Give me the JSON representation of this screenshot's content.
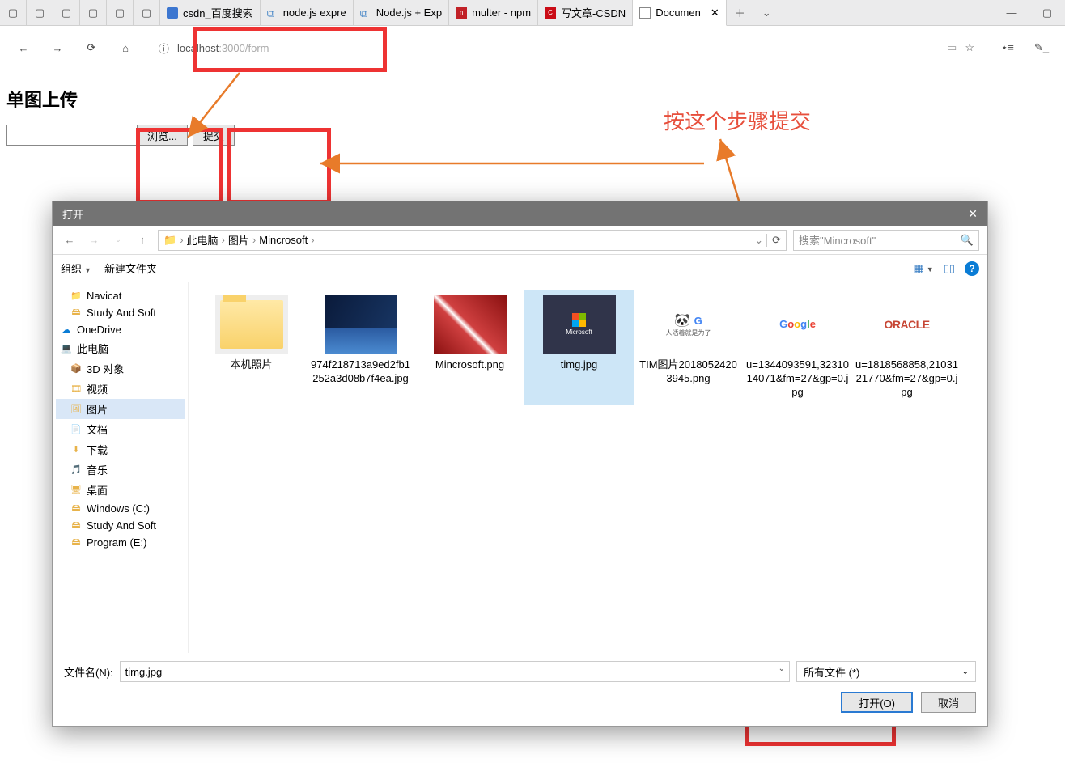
{
  "tabs": [
    {
      "label": "csdn_百度搜索"
    },
    {
      "label": "node.js expre"
    },
    {
      "label": "Node.js + Exp"
    },
    {
      "label": "multer - npm"
    },
    {
      "label": "写文章-CSDN"
    },
    {
      "label": "Documen",
      "active": true
    }
  ],
  "url": {
    "host": "localhost",
    "path": ":3000/form"
  },
  "page": {
    "heading": "单图上传",
    "browse": "浏览...",
    "submit": "提交"
  },
  "annotation": "按这个步骤提交",
  "dialog": {
    "title": "打开",
    "breadcrumb": [
      "此电脑",
      "图片",
      "Mincrosoft"
    ],
    "search_placeholder": "搜索\"Mincrosoft\"",
    "org": "组织",
    "newfolder": "新建文件夹",
    "tree": [
      {
        "label": "Navicat",
        "ico": "📁",
        "indent": 1
      },
      {
        "label": "Study And Soft",
        "ico": "🖴",
        "indent": 1
      },
      {
        "label": "OneDrive",
        "ico": "☁",
        "indent": 0,
        "color": "#0a7cd5"
      },
      {
        "label": "此电脑",
        "ico": "💻",
        "indent": 0,
        "color": "#4a8ad0"
      },
      {
        "label": "3D 对象",
        "ico": "📦",
        "indent": 1
      },
      {
        "label": "视频",
        "ico": "🎞",
        "indent": 1
      },
      {
        "label": "图片",
        "ico": "🖼",
        "indent": 1,
        "sel": true
      },
      {
        "label": "文档",
        "ico": "📄",
        "indent": 1
      },
      {
        "label": "下载",
        "ico": "⬇",
        "indent": 1
      },
      {
        "label": "音乐",
        "ico": "🎵",
        "indent": 1
      },
      {
        "label": "桌面",
        "ico": "🖥",
        "indent": 1
      },
      {
        "label": "Windows (C:)",
        "ico": "🖴",
        "indent": 1
      },
      {
        "label": "Study And Soft",
        "ico": "🖴",
        "indent": 1
      },
      {
        "label": "Program (E:)",
        "ico": "🖴",
        "indent": 1
      }
    ],
    "files": [
      {
        "name": "本机照片",
        "type": "folder"
      },
      {
        "name": "974f218713a9ed2fb1252a3d08b7f4ea.jpg",
        "type": "win"
      },
      {
        "name": "Mincrosoft.png",
        "type": "car"
      },
      {
        "name": "timg.jpg",
        "type": "ms",
        "sel": true
      },
      {
        "name": "TIM图片20180524203945.png",
        "type": "tim"
      },
      {
        "name": "u=1344093591,3231014071&fm=27&gp=0.jpg",
        "type": "google"
      },
      {
        "name": "u=1818568858,2103121770&fm=27&gp=0.jpg",
        "type": "oracle"
      }
    ],
    "fnlabel": "文件名(N):",
    "fnvalue": "timg.jpg",
    "filter": "所有文件 (*)",
    "open": "打开(O)",
    "cancel": "取消"
  }
}
